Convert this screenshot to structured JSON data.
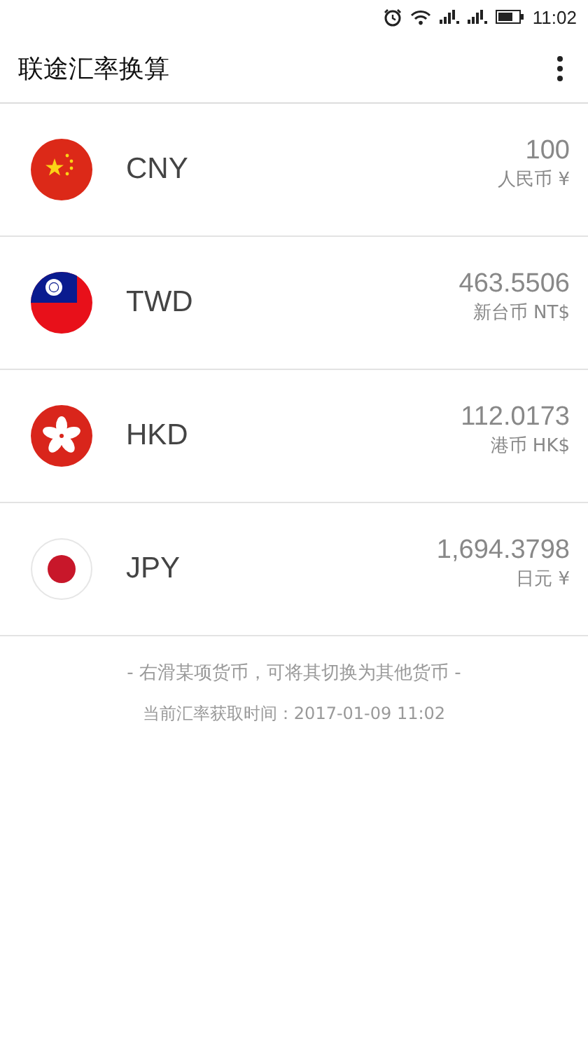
{
  "status_bar": {
    "time": "11:02"
  },
  "app_bar": {
    "title": "联途汇率换算"
  },
  "currencies": [
    {
      "kind": "cn",
      "code": "CNY",
      "amount": "100",
      "name": "人民币 ¥"
    },
    {
      "kind": "tw",
      "code": "TWD",
      "amount": "463.5506",
      "name": "新台币 NT$"
    },
    {
      "kind": "hk",
      "code": "HKD",
      "amount": "112.0173",
      "name": "港币 HK$"
    },
    {
      "kind": "jp",
      "code": "JPY",
      "amount": "1,694.3798",
      "name": "日元 ¥"
    }
  ],
  "footer": {
    "hint": "- 右滑某项货币，可将其切换为其他货币 -",
    "updated": "当前汇率获取时间：2017-01-09 11:02"
  }
}
